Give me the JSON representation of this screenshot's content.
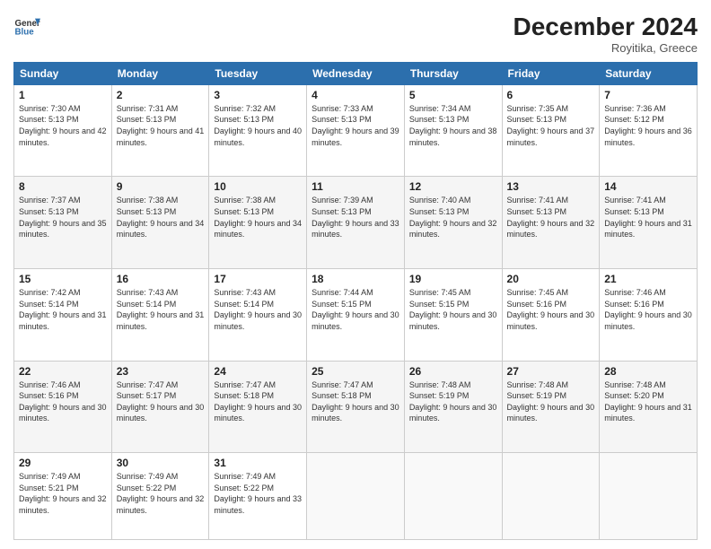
{
  "header": {
    "logo_line1": "General",
    "logo_line2": "Blue",
    "month": "December 2024",
    "location": "Royitika, Greece"
  },
  "weekdays": [
    "Sunday",
    "Monday",
    "Tuesday",
    "Wednesday",
    "Thursday",
    "Friday",
    "Saturday"
  ],
  "weeks": [
    [
      {
        "day": "1",
        "sunrise": "7:30 AM",
        "sunset": "5:13 PM",
        "daylight": "9 hours and 42 minutes."
      },
      {
        "day": "2",
        "sunrise": "7:31 AM",
        "sunset": "5:13 PM",
        "daylight": "9 hours and 41 minutes."
      },
      {
        "day": "3",
        "sunrise": "7:32 AM",
        "sunset": "5:13 PM",
        "daylight": "9 hours and 40 minutes."
      },
      {
        "day": "4",
        "sunrise": "7:33 AM",
        "sunset": "5:13 PM",
        "daylight": "9 hours and 39 minutes."
      },
      {
        "day": "5",
        "sunrise": "7:34 AM",
        "sunset": "5:13 PM",
        "daylight": "9 hours and 38 minutes."
      },
      {
        "day": "6",
        "sunrise": "7:35 AM",
        "sunset": "5:13 PM",
        "daylight": "9 hours and 37 minutes."
      },
      {
        "day": "7",
        "sunrise": "7:36 AM",
        "sunset": "5:12 PM",
        "daylight": "9 hours and 36 minutes."
      }
    ],
    [
      {
        "day": "8",
        "sunrise": "7:37 AM",
        "sunset": "5:13 PM",
        "daylight": "9 hours and 35 minutes."
      },
      {
        "day": "9",
        "sunrise": "7:38 AM",
        "sunset": "5:13 PM",
        "daylight": "9 hours and 34 minutes."
      },
      {
        "day": "10",
        "sunrise": "7:38 AM",
        "sunset": "5:13 PM",
        "daylight": "9 hours and 34 minutes."
      },
      {
        "day": "11",
        "sunrise": "7:39 AM",
        "sunset": "5:13 PM",
        "daylight": "9 hours and 33 minutes."
      },
      {
        "day": "12",
        "sunrise": "7:40 AM",
        "sunset": "5:13 PM",
        "daylight": "9 hours and 32 minutes."
      },
      {
        "day": "13",
        "sunrise": "7:41 AM",
        "sunset": "5:13 PM",
        "daylight": "9 hours and 32 minutes."
      },
      {
        "day": "14",
        "sunrise": "7:41 AM",
        "sunset": "5:13 PM",
        "daylight": "9 hours and 31 minutes."
      }
    ],
    [
      {
        "day": "15",
        "sunrise": "7:42 AM",
        "sunset": "5:14 PM",
        "daylight": "9 hours and 31 minutes."
      },
      {
        "day": "16",
        "sunrise": "7:43 AM",
        "sunset": "5:14 PM",
        "daylight": "9 hours and 31 minutes."
      },
      {
        "day": "17",
        "sunrise": "7:43 AM",
        "sunset": "5:14 PM",
        "daylight": "9 hours and 30 minutes."
      },
      {
        "day": "18",
        "sunrise": "7:44 AM",
        "sunset": "5:15 PM",
        "daylight": "9 hours and 30 minutes."
      },
      {
        "day": "19",
        "sunrise": "7:45 AM",
        "sunset": "5:15 PM",
        "daylight": "9 hours and 30 minutes."
      },
      {
        "day": "20",
        "sunrise": "7:45 AM",
        "sunset": "5:16 PM",
        "daylight": "9 hours and 30 minutes."
      },
      {
        "day": "21",
        "sunrise": "7:46 AM",
        "sunset": "5:16 PM",
        "daylight": "9 hours and 30 minutes."
      }
    ],
    [
      {
        "day": "22",
        "sunrise": "7:46 AM",
        "sunset": "5:16 PM",
        "daylight": "9 hours and 30 minutes."
      },
      {
        "day": "23",
        "sunrise": "7:47 AM",
        "sunset": "5:17 PM",
        "daylight": "9 hours and 30 minutes."
      },
      {
        "day": "24",
        "sunrise": "7:47 AM",
        "sunset": "5:18 PM",
        "daylight": "9 hours and 30 minutes."
      },
      {
        "day": "25",
        "sunrise": "7:47 AM",
        "sunset": "5:18 PM",
        "daylight": "9 hours and 30 minutes."
      },
      {
        "day": "26",
        "sunrise": "7:48 AM",
        "sunset": "5:19 PM",
        "daylight": "9 hours and 30 minutes."
      },
      {
        "day": "27",
        "sunrise": "7:48 AM",
        "sunset": "5:19 PM",
        "daylight": "9 hours and 30 minutes."
      },
      {
        "day": "28",
        "sunrise": "7:48 AM",
        "sunset": "5:20 PM",
        "daylight": "9 hours and 31 minutes."
      }
    ],
    [
      {
        "day": "29",
        "sunrise": "7:49 AM",
        "sunset": "5:21 PM",
        "daylight": "9 hours and 32 minutes."
      },
      {
        "day": "30",
        "sunrise": "7:49 AM",
        "sunset": "5:22 PM",
        "daylight": "9 hours and 32 minutes."
      },
      {
        "day": "31",
        "sunrise": "7:49 AM",
        "sunset": "5:22 PM",
        "daylight": "9 hours and 33 minutes."
      },
      null,
      null,
      null,
      null
    ]
  ]
}
